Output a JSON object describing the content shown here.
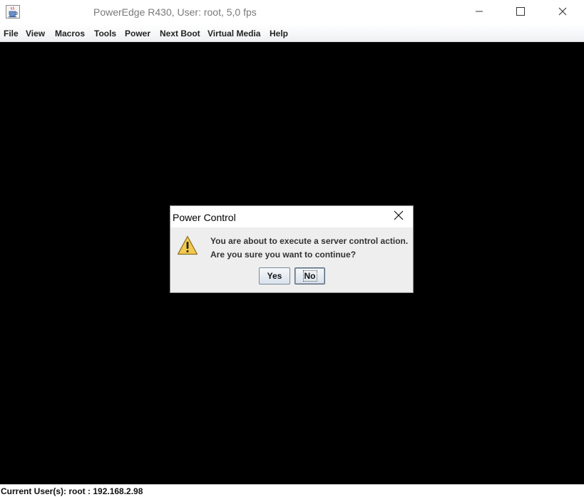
{
  "window": {
    "title": "PowerEdge R430, User: root, 5,0 fps"
  },
  "menubar": {
    "items": [
      "File",
      "View",
      "Macros",
      "Tools",
      "Power",
      "Next Boot",
      "Virtual Media",
      "Help"
    ]
  },
  "statusbar": {
    "text": "Current User(s): root : 192.168.2.98"
  },
  "dialog": {
    "title": "Power Control",
    "message_line1": "You are about to execute a server control action.",
    "message_line2": "Are you sure you want to continue?",
    "yes_label": "Yes",
    "no_label": "No"
  },
  "icons": {
    "app": "java-cup-icon",
    "warning": "warning-icon",
    "minimize": "minimize-icon",
    "maximize": "maximize-icon",
    "close": "close-icon"
  },
  "colors": {
    "console_background": "#000000",
    "warning_fill": "#f2c94c",
    "button_border": "#7a8a99"
  }
}
